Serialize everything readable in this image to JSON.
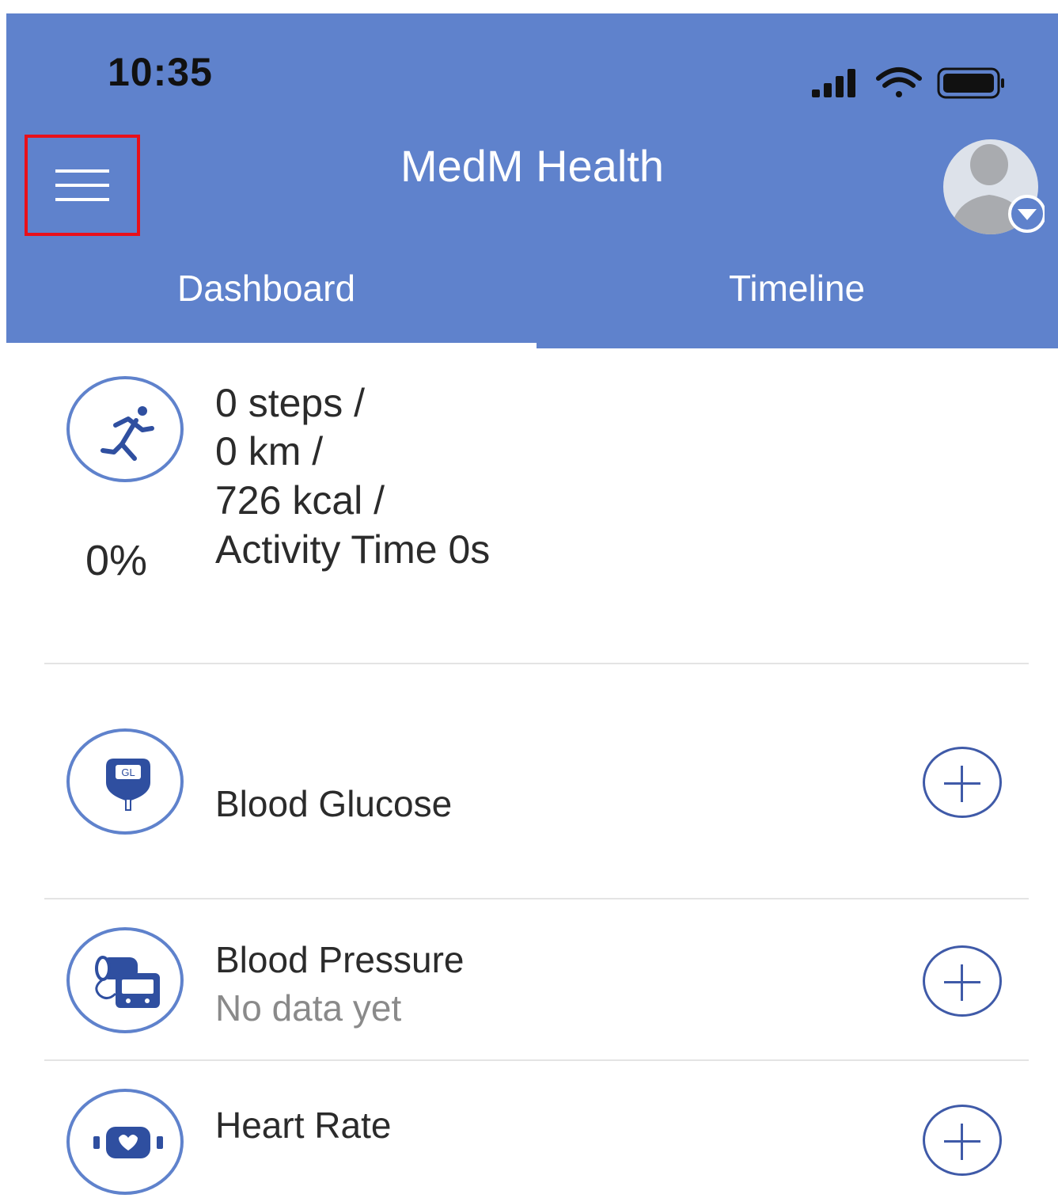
{
  "status_bar": {
    "time": "10:35",
    "icons": [
      "cellular-signal-icon",
      "wifi-icon",
      "battery-icon"
    ]
  },
  "header": {
    "title": "MedM Health",
    "menu_icon": "hamburger-menu-icon",
    "avatar_icon": "user-avatar-icon",
    "avatar_dropdown_icon": "chevron-down-icon"
  },
  "tabs": [
    {
      "label": "Dashboard",
      "selected": true
    },
    {
      "label": "Timeline",
      "selected": false
    }
  ],
  "activity": {
    "icon": "running-person-icon",
    "percent": "0%",
    "lines": [
      "0 steps /",
      "0 km /",
      "726 kcal /",
      "Activity Time 0s"
    ]
  },
  "measurements": [
    {
      "icon": "glucose-meter-icon",
      "label": "Blood Glucose",
      "status": "",
      "action_icon": "plus-icon"
    },
    {
      "icon": "blood-pressure-monitor-icon",
      "label": "Blood Pressure",
      "status": "No data yet",
      "action_icon": "plus-icon"
    },
    {
      "icon": "heart-rate-monitor-icon",
      "label": "Heart Rate",
      "status": "",
      "action_icon": "plus-icon"
    }
  ],
  "colors": {
    "header_bg": "#5f82cc",
    "accent": "#3f5aa8",
    "menu_highlight": "#e8101a"
  }
}
